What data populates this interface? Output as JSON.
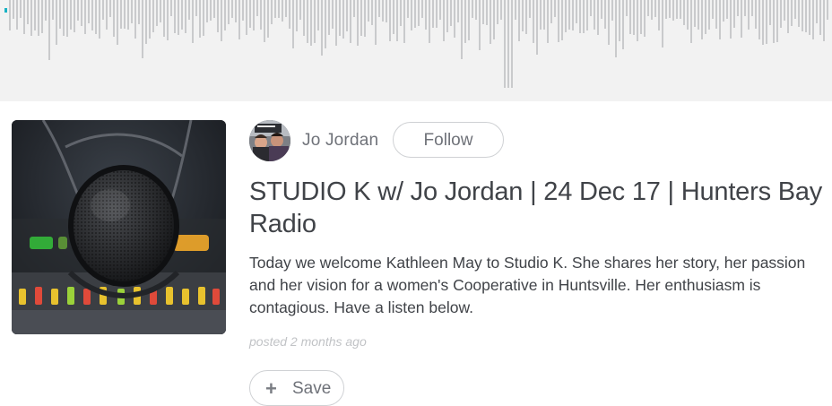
{
  "player": {
    "waveform_icon": "audio-waveform",
    "progress_color": "#19b2c4",
    "bar_color": "#c9cacc"
  },
  "post": {
    "cover_icon": "studio-microphone-image",
    "author": {
      "name": "Jo Jordan",
      "avatar_icon": "author-avatar-photo"
    },
    "follow_label": "Follow",
    "title": "STUDIO K w/ Jo Jordan | 24 Dec 17 | Hunters Bay Radio",
    "description": "Today we welcome Kathleen May to Studio K.  She shares her story, her passion and her vision for a women's Cooperative in Huntsville. Her enthusiasm is contagious. Have a listen below.",
    "posted": "posted 2 months ago",
    "save_label": "Save",
    "save_icon": "plus-icon"
  }
}
